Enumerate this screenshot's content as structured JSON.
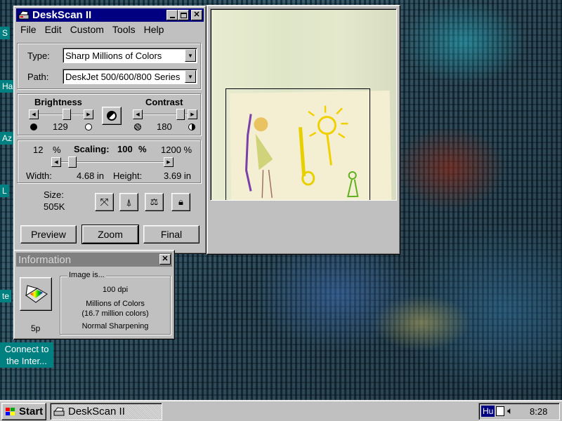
{
  "desktop": {
    "icons": [
      "S",
      "Ha",
      "Az",
      "L",
      "te"
    ],
    "connect_label": "Connect to the Inter..."
  },
  "window": {
    "title": "DeskScan II",
    "menu": [
      "File",
      "Edit",
      "Custom",
      "Tools",
      "Help"
    ]
  },
  "type": {
    "label": "Type:",
    "value": "Sharp Millions of Colors"
  },
  "path": {
    "label": "Path:",
    "value": "DeskJet 500/600/800 Series"
  },
  "brightness": {
    "label": "Brightness",
    "value": "129"
  },
  "contrast": {
    "label": "Contrast",
    "value": "180"
  },
  "scaling": {
    "min": "12",
    "min_unit": "%",
    "label": "Scaling:",
    "value": "100",
    "value_unit": "%",
    "max": "1200 %"
  },
  "dimensions": {
    "width_label": "Width:",
    "width_value": "4.68 in",
    "height_label": "Height:",
    "height_value": "3.69 in"
  },
  "size": {
    "label": "Size:",
    "value": "505K"
  },
  "buttons": {
    "preview": "Preview",
    "zoom": "Zoom",
    "final": "Final"
  },
  "info": {
    "title": "Information",
    "group_label": "Image is...",
    "dpi": "100 dpi",
    "colors1": "Millions of Colors",
    "colors2": "(16.7 million colors)",
    "sharpening": "Normal Sharpening",
    "count": "5p"
  },
  "taskbar": {
    "start": "Start",
    "task": "DeskScan II",
    "lang": "Hu",
    "time": "8:28"
  },
  "colors": {
    "title_active": "#000080",
    "title_inactive": "#808080",
    "face": "#c0c0c0",
    "desktop_teal": "#008080"
  }
}
